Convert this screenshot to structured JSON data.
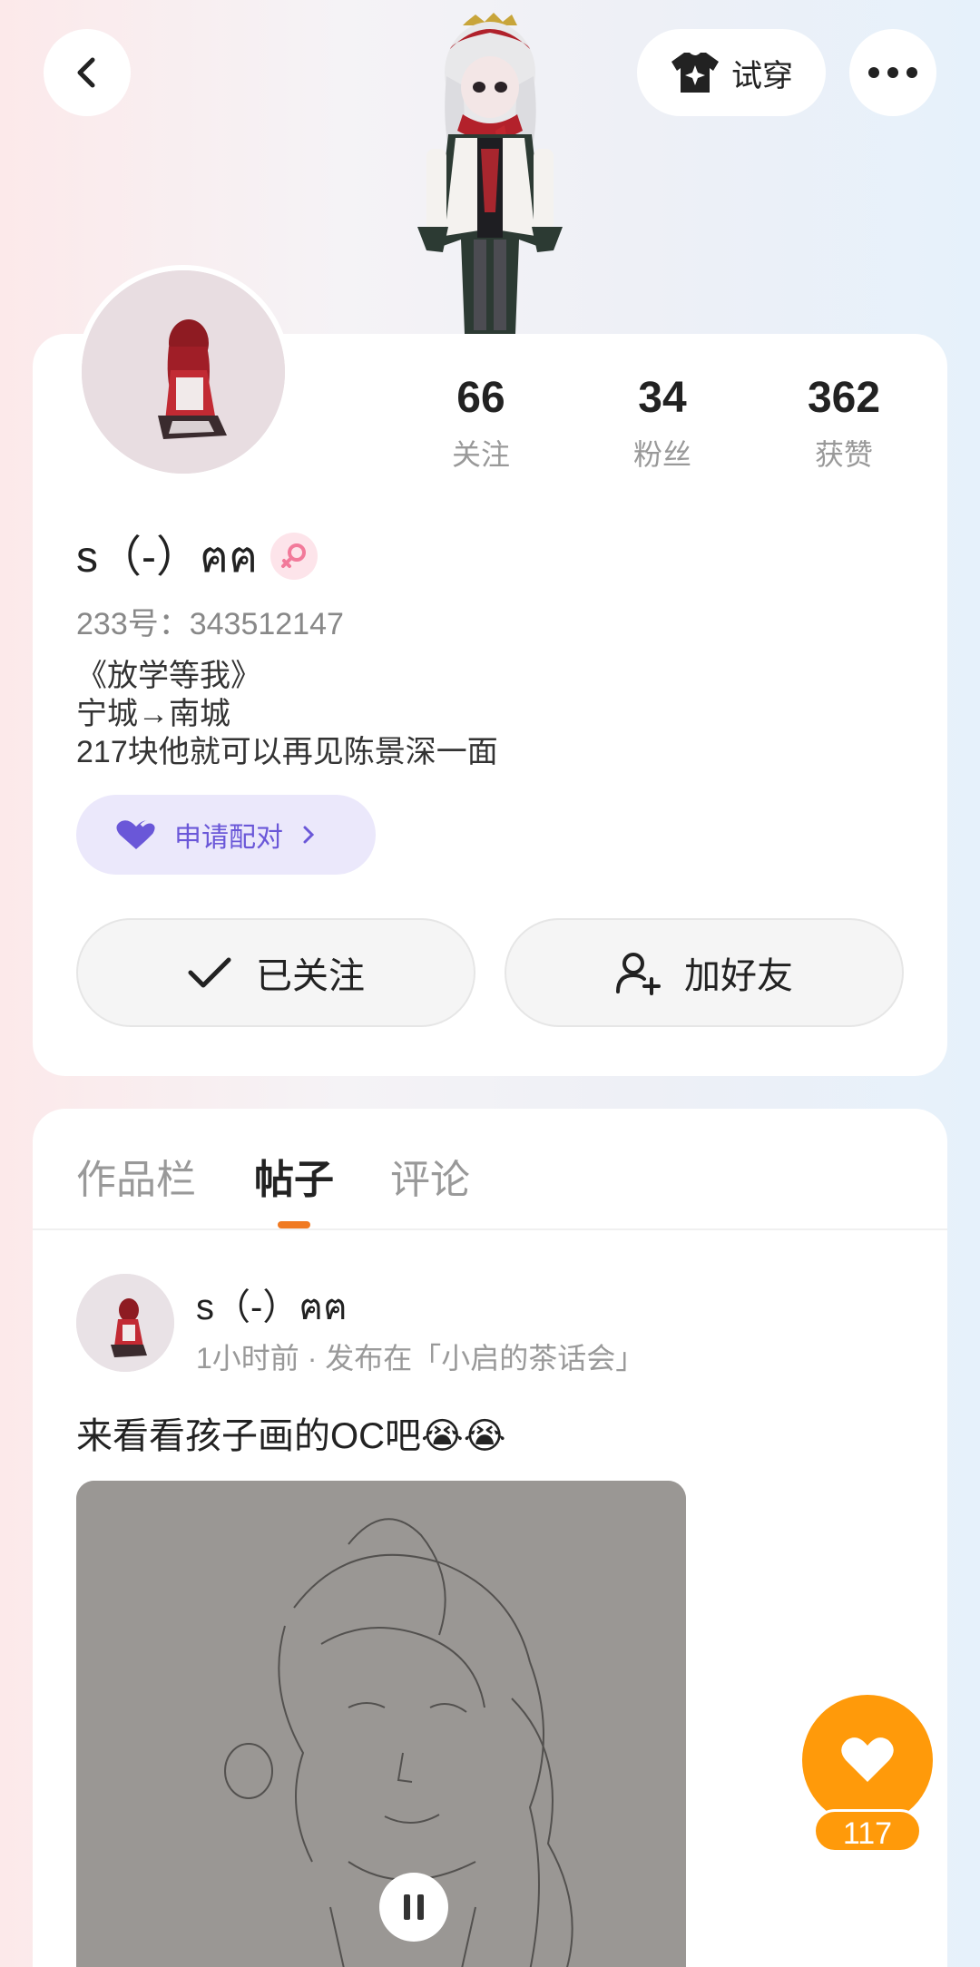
{
  "header": {
    "back_icon": "chevron-left-icon",
    "tryon_label": "试穿",
    "tryon_icon": "shirt-sparkle-icon",
    "more_icon": "more-dots-icon"
  },
  "profile": {
    "stats": [
      {
        "value": "66",
        "label": "关注"
      },
      {
        "value": "34",
        "label": "粉丝"
      },
      {
        "value": "362",
        "label": "获赞"
      }
    ],
    "username": "s（-）ฅฅ",
    "gender_icon": "female-icon",
    "uid": "233号：343512147",
    "bio": [
      "《放学等我》",
      "宁城→南城",
      "217块他就可以再见陈景深一面"
    ],
    "pair_label": "申请配对",
    "follow_label": "已关注",
    "add_friend_label": "加好友"
  },
  "tabs": [
    {
      "label": "作品栏"
    },
    {
      "label": "帖子"
    },
    {
      "label": "评论"
    }
  ],
  "post": {
    "author": "s（-）ฅฅ",
    "meta": "1小时前 · 发布在「小启的茶话会」",
    "text": "来看看孩子画的OC吧😭😭"
  },
  "like": {
    "count": "117"
  },
  "colors": {
    "accent_orange": "#ff9a0a",
    "tab_indicator": "#f07a22",
    "pair_purple": "#6a57d8"
  }
}
